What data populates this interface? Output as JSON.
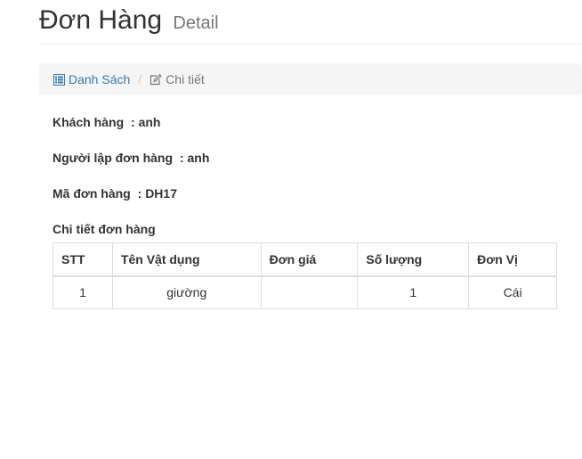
{
  "header": {
    "title": "Đơn Hàng",
    "subtitle": "Detail"
  },
  "breadcrumb": {
    "list_label": "Danh Sách",
    "list_icon": "list-icon",
    "detail_label": "Chi tiết",
    "detail_icon": "edit-icon",
    "separator": "/"
  },
  "info": {
    "customer_label": "Khách hàng",
    "customer_value": "anh",
    "creator_label": "Người lập đơn hàng",
    "creator_value": "anh",
    "order_code_label": "Mã đơn hàng",
    "order_code_value": "DH17",
    "separator": ":"
  },
  "details": {
    "heading": "Chi tiết đơn hàng",
    "columns": [
      "STT",
      "Tên Vật dụng",
      "Đơn giá",
      "Số lượng",
      "Đơn Vị"
    ],
    "rows": [
      {
        "stt": "1",
        "name": "giường",
        "price": "",
        "quantity": "1",
        "unit": "Cái"
      }
    ]
  },
  "colors": {
    "link": "#337ab7",
    "breadcrumb_bg": "#f5f5f5",
    "border": "#dddddd"
  }
}
